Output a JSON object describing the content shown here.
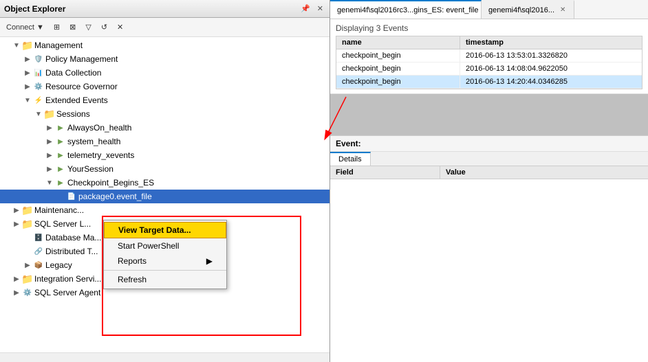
{
  "object_explorer": {
    "title": "Object Explorer",
    "toolbar": {
      "connect_label": "Connect ▼",
      "icons": [
        "⊞",
        "⊠",
        "▽",
        "↺",
        "✕"
      ]
    },
    "tree": {
      "items": [
        {
          "id": "management",
          "label": "Management",
          "indent": 1,
          "icon": "folder",
          "expanded": true,
          "expander": "▼"
        },
        {
          "id": "policy-mgmt",
          "label": "Policy Management",
          "indent": 2,
          "icon": "mgmt",
          "expanded": false,
          "expander": "▶"
        },
        {
          "id": "data-collection",
          "label": "Data Collection",
          "indent": 2,
          "icon": "mgmt",
          "expanded": false,
          "expander": "▶"
        },
        {
          "id": "resource-governor",
          "label": "Resource Governor",
          "indent": 2,
          "icon": "mgmt",
          "expanded": false,
          "expander": "▶"
        },
        {
          "id": "extended-events",
          "label": "Extended Events",
          "indent": 2,
          "icon": "mgmt",
          "expanded": true,
          "expander": "▼"
        },
        {
          "id": "sessions",
          "label": "Sessions",
          "indent": 3,
          "icon": "folder",
          "expanded": true,
          "expander": "▼"
        },
        {
          "id": "always-on",
          "label": "AlwaysOn_health",
          "indent": 4,
          "icon": "session",
          "expanded": false,
          "expander": "▶"
        },
        {
          "id": "system-health",
          "label": "system_health",
          "indent": 4,
          "icon": "session",
          "expanded": false,
          "expander": "▶"
        },
        {
          "id": "telemetry",
          "label": "telemetry_xevents",
          "indent": 4,
          "icon": "session",
          "expanded": false,
          "expander": "▶"
        },
        {
          "id": "your-session",
          "label": "YourSession",
          "indent": 4,
          "icon": "session",
          "expanded": false,
          "expander": "▶"
        },
        {
          "id": "checkpoint",
          "label": "Checkpoint_Begins_ES",
          "indent": 4,
          "icon": "session",
          "expanded": true,
          "expander": "▼"
        },
        {
          "id": "package0",
          "label": "package0.event_file",
          "indent": 5,
          "icon": "target",
          "expanded": false,
          "expander": "",
          "selected": true
        },
        {
          "id": "maintenance",
          "label": "Maintenanc...",
          "indent": 1,
          "icon": "folder",
          "expanded": false,
          "expander": "▶"
        },
        {
          "id": "sql-server",
          "label": "SQL Server...",
          "indent": 1,
          "icon": "folder",
          "expanded": false,
          "expander": "▶"
        },
        {
          "id": "database-ma",
          "label": "Database Ma...",
          "indent": 2,
          "icon": "mgmt",
          "expanded": false,
          "expander": ""
        },
        {
          "id": "distributed",
          "label": "Distributed T...",
          "indent": 2,
          "icon": "mgmt",
          "expanded": false,
          "expander": ""
        },
        {
          "id": "legacy",
          "label": "Legacy",
          "indent": 2,
          "icon": "mgmt",
          "expanded": false,
          "expander": "▶"
        },
        {
          "id": "integration",
          "label": "Integration Servi...",
          "indent": 1,
          "icon": "folder",
          "expanded": false,
          "expander": "▶"
        },
        {
          "id": "sql-agent",
          "label": "SQL Server Agent",
          "indent": 1,
          "icon": "mgmt",
          "expanded": false,
          "expander": "▶"
        }
      ]
    },
    "context_menu": {
      "items": [
        {
          "id": "view-target",
          "label": "View Target Data...",
          "highlighted": true
        },
        {
          "id": "start-ps",
          "label": "Start PowerShell"
        },
        {
          "id": "reports",
          "label": "Reports",
          "has_submenu": true
        },
        {
          "id": "refresh",
          "label": "Refresh"
        }
      ]
    }
  },
  "right_panel": {
    "tabs": [
      {
        "id": "event-file-tab",
        "label": "genemi4f\\sql2016rc3...gins_ES: event_file",
        "active": true
      },
      {
        "id": "other-tab",
        "label": "genemi4f\\sql2016...",
        "active": false
      }
    ],
    "events_header": "Displaying 3 Events",
    "grid_columns": [
      "name",
      "timestamp"
    ],
    "grid_rows": [
      {
        "name": "checkpoint_begin",
        "timestamp": "2016-06-13 13:53:01.3326820"
      },
      {
        "name": "checkpoint_begin",
        "timestamp": "2016-06-13 14:08:04.9622050"
      },
      {
        "name": "checkpoint_begin",
        "timestamp": "2016-06-13 14:20:44.0346285"
      }
    ],
    "event_section": {
      "header": "Event:",
      "tabs": [
        {
          "id": "details-tab",
          "label": "Details",
          "active": true
        }
      ],
      "grid_columns": [
        "Field",
        "Value"
      ]
    }
  }
}
